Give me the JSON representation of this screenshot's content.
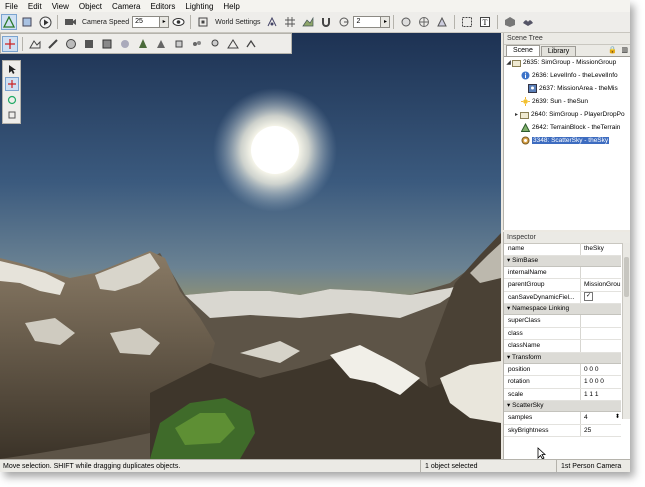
{
  "menu": [
    "File",
    "Edit",
    "View",
    "Object",
    "Camera",
    "Editors",
    "Lighting",
    "Help"
  ],
  "toolbar": {
    "camera_speed_label": "Camera Speed",
    "camera_speed_value": "25",
    "world_settings_label": "World Settings",
    "snap_value": "2"
  },
  "scene_tree": {
    "title": "Scene Tree",
    "tabs": [
      "Scene",
      "Library"
    ],
    "items": [
      {
        "label": "2635: SimGroup - MissionGroup",
        "icon": "folder-icon"
      },
      {
        "label": "2636: LevelInfo - theLevelInfo",
        "icon": "info-icon"
      },
      {
        "label": "2637: MissionArea - theMis",
        "icon": "mission-area-icon"
      },
      {
        "label": "2639: Sun - theSun",
        "icon": "sun-icon"
      },
      {
        "label": "2640: SimGroup - PlayerDropPo",
        "icon": "folder-icon"
      },
      {
        "label": "2642: TerrainBlock - theTerrain",
        "icon": "terrain-icon"
      },
      {
        "label": "3348: ScatterSky - theSky",
        "icon": "sky-icon"
      }
    ]
  },
  "inspector": {
    "title": "Inspector",
    "name_label": "name",
    "name_value": "theSky",
    "groups": {
      "simbase": "SimBase",
      "namespace": "Namespace Linking",
      "transform": "Transform",
      "scattersky": "ScatterSky"
    },
    "fields": {
      "internal_name": "internalName",
      "parent_group": "parentGroup",
      "parent_group_value": "MissionGrou",
      "can_save": "canSaveDynamicFiel...",
      "can_save_value": "✓",
      "super_class": "superClass",
      "class": "class",
      "class_name": "className",
      "position": "position",
      "position_value": "0 0 0",
      "rotation": "rotation",
      "rotation_value": "1 0 0 0",
      "scale": "scale",
      "scale_value": "1 1 1",
      "samples": "samples",
      "samples_value": "4",
      "sky_brightness": "skyBrightness",
      "sky_brightness_value": "25"
    }
  },
  "status": {
    "hint": "Move selection.  SHIFT while dragging duplicates objects.",
    "selection": "1 object selected",
    "camera": "1st Person Camera"
  },
  "colors": {
    "selection": "#3d6cc0",
    "sky_top": "#1f3556",
    "sky_horizon": "#b19a4e"
  }
}
